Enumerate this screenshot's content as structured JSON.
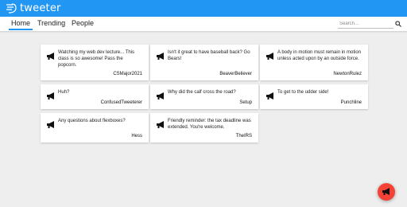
{
  "app": {
    "title": "tweeter"
  },
  "nav": {
    "tabs": [
      {
        "label": "Home"
      },
      {
        "label": "Trending"
      },
      {
        "label": "People"
      }
    ],
    "search_placeholder": "Search..."
  },
  "tweets": [
    {
      "text": "Watching my web dev lecture... This class is so awesome! Pass the popcorn.",
      "author": "CSMajor2021"
    },
    {
      "text": "Isn't it great to have baseball back? Go Bears!",
      "author": "BeaverBeliever"
    },
    {
      "text": "A body in motion must remain in motion unless acted upon by an outside force.",
      "author": "NewtonRulez"
    },
    {
      "text": "Huh?",
      "author": "ConfusedTweeterer"
    },
    {
      "text": "Why did the calf cross the road?",
      "author": "Setup"
    },
    {
      "text": "To get to the udder side!",
      "author": "Punchline"
    },
    {
      "text": "Any questions about flexboxes?",
      "author": "Hess"
    },
    {
      "text": "Friendly reminder: the tax deadline was extended. You're welcome.",
      "author": "TheIRS"
    }
  ],
  "colors": {
    "primary": "#2196f3",
    "accent": "#f44336",
    "background": "#eeeeee"
  },
  "icons": {
    "logo": "bird-logo-icon",
    "tweet": "megaphone-icon",
    "search": "search-icon",
    "fab": "megaphone-icon"
  }
}
